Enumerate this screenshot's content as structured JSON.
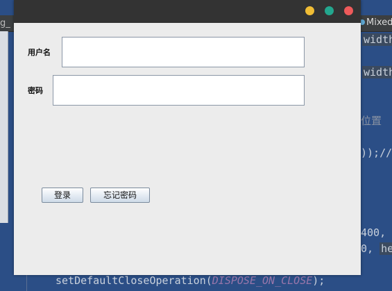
{
  "ide": {
    "left_tab_fragment": "g_",
    "right_tab_label": "Mixed",
    "code_lines": [
      {
        "text": "width",
        "highlight": true
      },
      {
        "text": "width",
        "highlight": true
      },
      {
        "text": "位置",
        "comment": true
      },
      {
        "text": "));//"
      },
      {
        "text": "400,"
      },
      {
        "text": "0,"
      },
      {
        "text": "he",
        "highlight": true
      }
    ],
    "bottom_call": {
      "before": "setDefaultCloseOperation(",
      "constant": "DISPOSE_ON_CLOSE",
      "after": ");"
    }
  },
  "window": {
    "buttons": [
      "minimize",
      "maximize",
      "close"
    ],
    "colors": {
      "minimize": "#f0bd35",
      "maximize": "#23a78e",
      "close": "#ee5a5a"
    }
  },
  "form": {
    "username_label": "用户名",
    "username_value": "",
    "password_label": "密码",
    "password_value": "",
    "login_button": "登录",
    "forgot_button": "忘记密码"
  }
}
